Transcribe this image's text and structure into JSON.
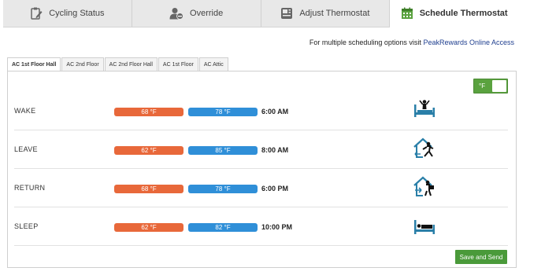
{
  "nav": {
    "tabs": [
      {
        "label": "Cycling Status",
        "icon": "clipboard-edit-icon"
      },
      {
        "label": "Override",
        "icon": "user-minus-icon"
      },
      {
        "label": "Adjust Thermostat",
        "icon": "thermostat-icon"
      },
      {
        "label": "Schedule Thermostat",
        "icon": "calendar-icon",
        "active": true
      }
    ]
  },
  "notice": {
    "text": "For multiple scheduling options visit ",
    "link": "PeakRewards Online Access"
  },
  "zones": [
    {
      "label": "AC 1st Floor Hall",
      "active": true
    },
    {
      "label": "AC 2nd Floor"
    },
    {
      "label": "AC 2nd Floor Hall"
    },
    {
      "label": "AC 1st Floor"
    },
    {
      "label": "AC Attic"
    }
  ],
  "unit_toggle": {
    "label": "°F"
  },
  "schedule": [
    {
      "name": "WAKE",
      "heat": "68 °F",
      "cool": "78 °F",
      "time": "6:00 AM",
      "icon": "wake-up-icon"
    },
    {
      "name": "LEAVE",
      "heat": "62 °F",
      "cool": "85 °F",
      "time": "8:00 AM",
      "icon": "leave-home-icon"
    },
    {
      "name": "RETURN",
      "heat": "68 °F",
      "cool": "78 °F",
      "time": "6:00 PM",
      "icon": "return-home-icon"
    },
    {
      "name": "SLEEP",
      "heat": "62 °F",
      "cool": "82 °F",
      "time": "10:00 PM",
      "icon": "sleep-icon"
    }
  ],
  "save_label": "Save and Send",
  "colors": {
    "heat": "#e8683a",
    "cool": "#2f8fd8",
    "accent": "#4a9a3a",
    "icon": "#2a7fa8"
  }
}
